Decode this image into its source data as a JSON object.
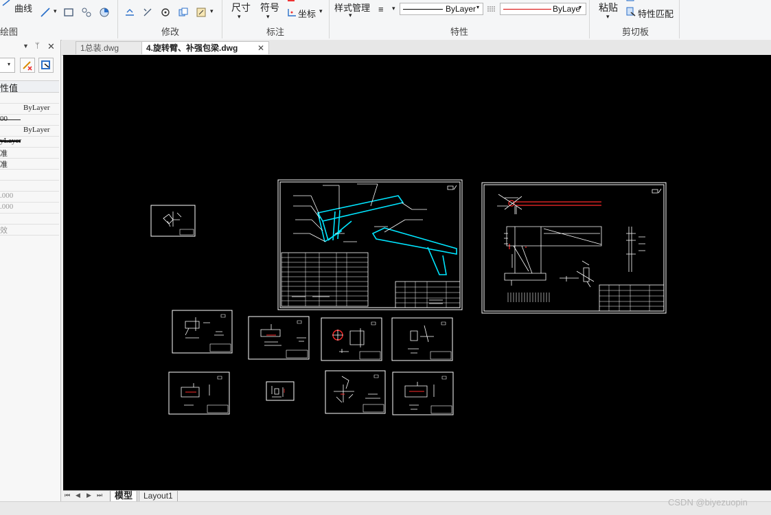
{
  "ribbon": {
    "draw_curve": "曲线",
    "draw_group": "绘图",
    "modify_group": "修改",
    "dimension_label": "尺寸",
    "symbol_label": "符号",
    "coord_label": "坐标",
    "annotation_group": "标注",
    "style_manager": "样式管理",
    "linetype_value": "ByLayer",
    "color_value": "ByLaye",
    "properties_group": "特性",
    "paste_label": "粘贴",
    "match_props": "特性匹配",
    "clipboard_group": "剪切板"
  },
  "panel": {
    "header_value": "性值",
    "rows": [
      {
        "text": "",
        "dim": false
      },
      {
        "text": "ByLayer",
        "dim": false
      },
      {
        "text": "00",
        "dim": false
      },
      {
        "text": "ByLayer",
        "dim": false
      },
      {
        "text": "yLayer",
        "dim": false
      },
      {
        "text": "准",
        "dim": false
      },
      {
        "text": "准",
        "dim": false
      },
      {
        "text": "",
        "dim": false
      },
      {
        "text": "",
        "dim": false
      },
      {
        "text": ".000",
        "dim": true
      },
      {
        "text": ".000",
        "dim": true
      },
      {
        "text": "",
        "dim": false
      },
      {
        "text": "效",
        "dim": true
      }
    ]
  },
  "tabs": [
    {
      "label": "1总装.dwg",
      "active": false
    },
    {
      "label": "4.旋转臂、补强包梁.dwg",
      "active": true
    }
  ],
  "layout_tabs": [
    {
      "label": "模型",
      "active": true
    },
    {
      "label": "Layout1",
      "active": false
    }
  ],
  "watermark": "CSDN @biyezuopin",
  "colors": {
    "canvas": "#000000",
    "drawing_line": "#ffffff",
    "highlight": "#00e5ff",
    "red": "#ff2a2a"
  }
}
